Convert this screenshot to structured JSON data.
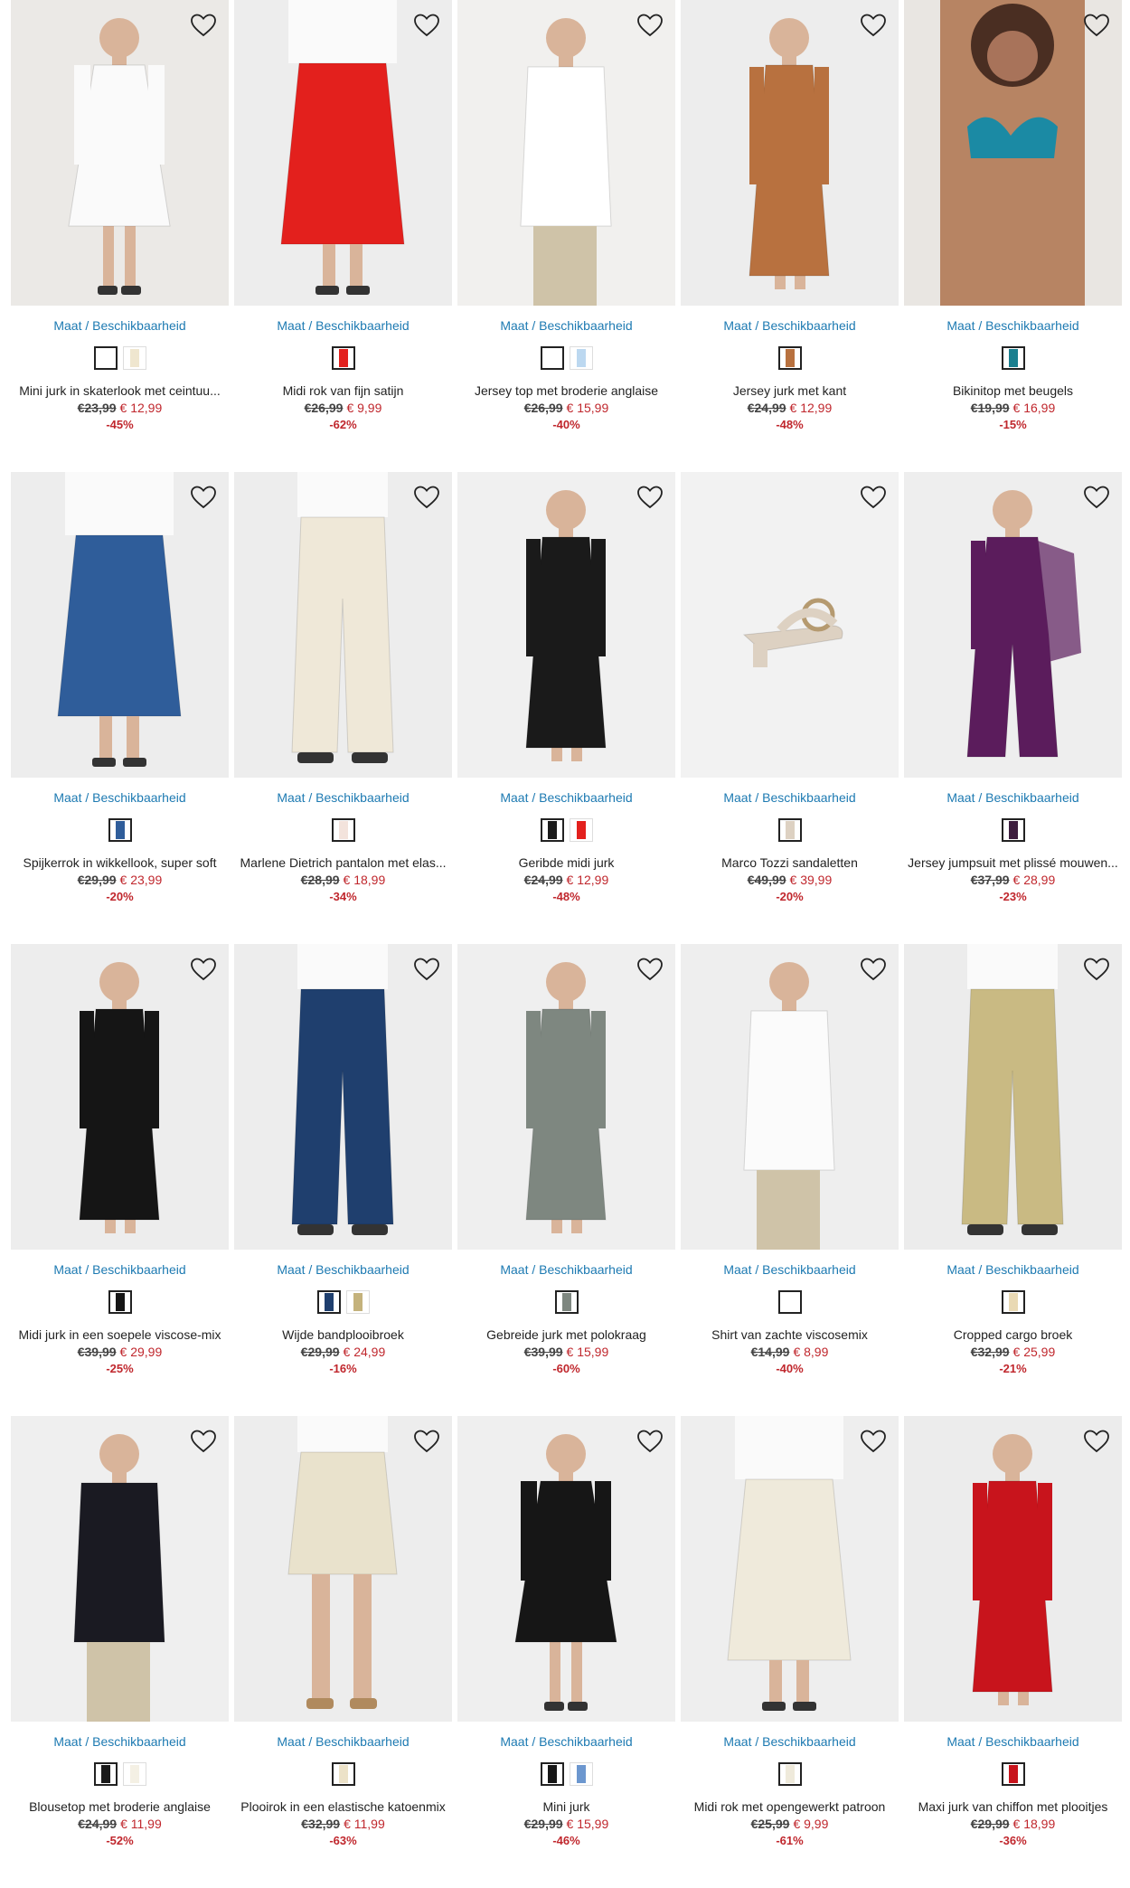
{
  "labels": {
    "size_link": "Maat / Beschikbaarheid"
  },
  "colors": {
    "accent_link": "#1d7ab2",
    "sale": "#c0272d"
  },
  "products": [
    {
      "name": "Mini jurk in skaterlook met ceintuu...",
      "old": "€23,99",
      "new": "€ 12,99",
      "disc": "-45%",
      "bg": "#ebe9e6",
      "main": "#fafafa",
      "swatches": [
        "#ffffff",
        "#efe6cf"
      ],
      "kind": "dress-short",
      "icon": "favorite-heart-icon"
    },
    {
      "name": "Midi rok van fijn satijn",
      "old": "€26,99",
      "new": "€ 9,99",
      "disc": "-62%",
      "bg": "#ededed",
      "main": "#e3201d",
      "swatches": [
        "#e3201d"
      ],
      "kind": "skirt",
      "icon": "favorite-heart-icon"
    },
    {
      "name": "Jersey top met broderie anglaise",
      "old": "€26,99",
      "new": "€ 15,99",
      "disc": "-40%",
      "bg": "#f1f0ee",
      "main": "#ffffff",
      "swatches": [
        "#ffffff",
        "#bcd8f0"
      ],
      "kind": "top",
      "icon": "favorite-heart-icon"
    },
    {
      "name": "Jersey jurk met kant",
      "old": "€24,99",
      "new": "€ 12,99",
      "disc": "-48%",
      "bg": "#ededed",
      "main": "#b8713f",
      "swatches": [
        "#b8713f"
      ],
      "kind": "dress-long",
      "icon": "favorite-heart-icon"
    },
    {
      "name": "Bikinitop met beugels",
      "old": "€19,99",
      "new": "€ 16,99",
      "disc": "-15%",
      "bg": "#e9e6e2",
      "main": "#1b8aa4",
      "swatches": [
        "#1b7f8f"
      ],
      "kind": "bikini",
      "icon": "favorite-heart-icon"
    },
    {
      "name": "Spijkerrok in wikkellook, super soft",
      "old": "€29,99",
      "new": "€ 23,99",
      "disc": "-20%",
      "bg": "#ededed",
      "main": "#2f5d9a",
      "swatches": [
        "#2f5d9a"
      ],
      "kind": "skirt",
      "icon": "favorite-heart-icon"
    },
    {
      "name": "Marlene Dietrich pantalon met elas...",
      "old": "€28,99",
      "new": "€ 18,99",
      "disc": "-34%",
      "bg": "#ededed",
      "main": "#efe8d8",
      "swatches": [
        "#f3e3dc"
      ],
      "kind": "pants",
      "icon": "favorite-heart-icon"
    },
    {
      "name": "Geribde midi jurk",
      "old": "€24,99",
      "new": "€ 12,99",
      "disc": "-48%",
      "bg": "#f0f0f0",
      "main": "#1a1a1a",
      "swatches": [
        "#1a1a1a",
        "#e3201d"
      ],
      "kind": "dress-long",
      "icon": "favorite-heart-icon"
    },
    {
      "name": "Marco Tozzi sandaletten",
      "old": "€49,99",
      "new": "€ 39,99",
      "disc": "-20%",
      "bg": "#f2f2f2",
      "main": "#ddd1c2",
      "swatches": [
        "#ddd1c2"
      ],
      "kind": "shoe",
      "icon": "favorite-heart-icon"
    },
    {
      "name": "Jersey jumpsuit met plissé mouwen...",
      "old": "€37,99",
      "new": "€ 28,99",
      "disc": "-23%",
      "bg": "#eeeeee",
      "main": "#5b1c5c",
      "swatches": [
        "#3d1d3e"
      ],
      "kind": "jumpsuit",
      "icon": "favorite-heart-icon"
    },
    {
      "name": "Midi jurk in een soepele viscose-mix",
      "old": "€39,99",
      "new": "€ 29,99",
      "disc": "-25%",
      "bg": "#ededed",
      "main": "#151515",
      "swatches": [
        "#151515"
      ],
      "kind": "dress-long",
      "icon": "favorite-heart-icon"
    },
    {
      "name": "Wijde bandplooibroek",
      "old": "€29,99",
      "new": "€ 24,99",
      "disc": "-16%",
      "bg": "#ededed",
      "main": "#1f3f6e",
      "swatches": [
        "#1f3f6e",
        "#c4b27c"
      ],
      "kind": "pants",
      "icon": "favorite-heart-icon"
    },
    {
      "name": "Gebreide jurk met polokraag",
      "old": "€39,99",
      "new": "€ 15,99",
      "disc": "-60%",
      "bg": "#efefef",
      "main": "#7e8780",
      "swatches": [
        "#7e8780"
      ],
      "kind": "dress-long",
      "icon": "favorite-heart-icon"
    },
    {
      "name": "Shirt van zachte viscosemix",
      "old": "€14,99",
      "new": "€ 8,99",
      "disc": "-40%",
      "bg": "#eeeeee",
      "main": "#fbfbfb",
      "swatches": [
        "#ffffff"
      ],
      "kind": "top",
      "icon": "favorite-heart-icon"
    },
    {
      "name": "Cropped cargo broek",
      "old": "€32,99",
      "new": "€ 25,99",
      "disc": "-21%",
      "bg": "#ececec",
      "main": "#c9ba83",
      "swatches": [
        "#e9d9b4"
      ],
      "kind": "pants",
      "icon": "favorite-heart-icon"
    },
    {
      "name": "Blousetop met broderie anglaise",
      "old": "€24,99",
      "new": "€ 11,99",
      "disc": "-52%",
      "bg": "#efefef",
      "main": "#1a1a22",
      "swatches": [
        "#1a1a1a",
        "#f4f0e4"
      ],
      "kind": "top",
      "icon": "favorite-heart-icon"
    },
    {
      "name": "Plooirok in een elastische katoenmix",
      "old": "€32,99",
      "new": "€ 11,99",
      "disc": "-63%",
      "bg": "#ededed",
      "main": "#e9e2cc",
      "swatches": [
        "#ece2c8"
      ],
      "kind": "skirt-short",
      "icon": "favorite-heart-icon"
    },
    {
      "name": "Mini jurk",
      "old": "€29,99",
      "new": "€ 15,99",
      "disc": "-46%",
      "bg": "#efefef",
      "main": "#161616",
      "swatches": [
        "#161616",
        "#6c97cf"
      ],
      "kind": "dress-short",
      "icon": "favorite-heart-icon"
    },
    {
      "name": "Midi rok met opengewerkt patroon",
      "old": "€25,99",
      "new": "€ 9,99",
      "disc": "-61%",
      "bg": "#eeeeee",
      "main": "#efeadb",
      "swatches": [
        "#efeadb"
      ],
      "kind": "skirt",
      "icon": "favorite-heart-icon"
    },
    {
      "name": "Maxi jurk van chiffon met plooitjes",
      "old": "€29,99",
      "new": "€ 18,99",
      "disc": "-36%",
      "bg": "#ececec",
      "main": "#c8141c",
      "swatches": [
        "#c8141c"
      ],
      "kind": "dress-long",
      "icon": "favorite-heart-icon"
    }
  ]
}
